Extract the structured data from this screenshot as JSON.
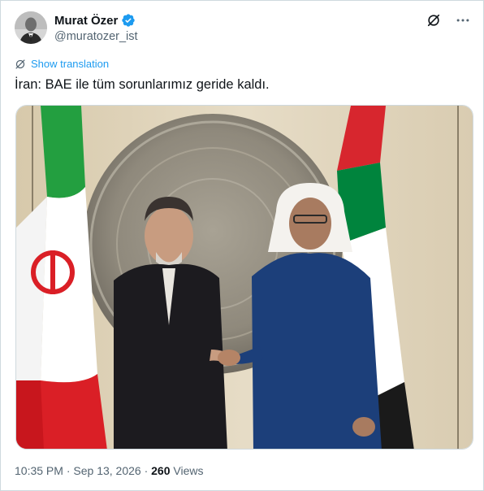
{
  "author": {
    "name": "Murat Özer",
    "handle": "@muratozer_ist",
    "verified_color": "#1d9bf0"
  },
  "actions": {
    "grok_icon": "slash-circle-icon",
    "more_icon": "more-icon"
  },
  "translate_label": "Show translation",
  "text": "İran: BAE ile tüm sorunlarımız geride kaldı.",
  "meta": {
    "time": "10:35 PM",
    "separator": " · ",
    "date": "Sep 13, 2026",
    "views_count": "260",
    "views_label": "Views"
  }
}
